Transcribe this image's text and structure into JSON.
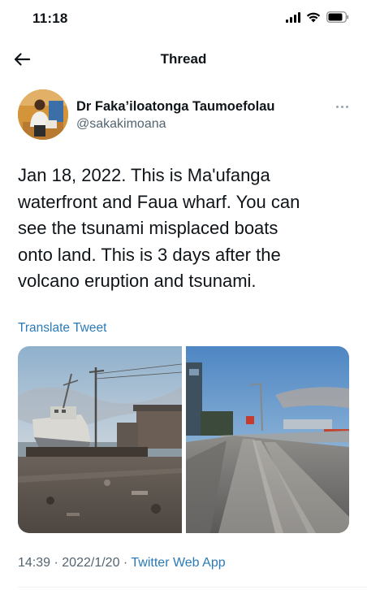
{
  "status_bar": {
    "time": "11:18"
  },
  "nav": {
    "title": "Thread"
  },
  "author": {
    "name": "Dr Faka’iloatonga Taumoefolau",
    "handle": "@sakakimoana"
  },
  "tweet": {
    "lines": [
      "Jan 18, 2022. This is Ma'ufanga",
      "waterfront and Faua wharf. You can",
      "see the tsunami misplaced boats",
      "onto land. This is 3 days after the",
      "volcano eruption and tsunami."
    ],
    "translate_label": "Translate Tweet",
    "time": "14:39",
    "separator": "·",
    "date": "2022/1/20",
    "source": "Twitter Web App"
  },
  "media": [
    {
      "icon": "photo-boat-on-wharf"
    },
    {
      "icon": "photo-ash-covered-road"
    }
  ],
  "colors": {
    "link": "#2a7ab8",
    "secondary_text": "#536471",
    "text": "#0f1419"
  }
}
